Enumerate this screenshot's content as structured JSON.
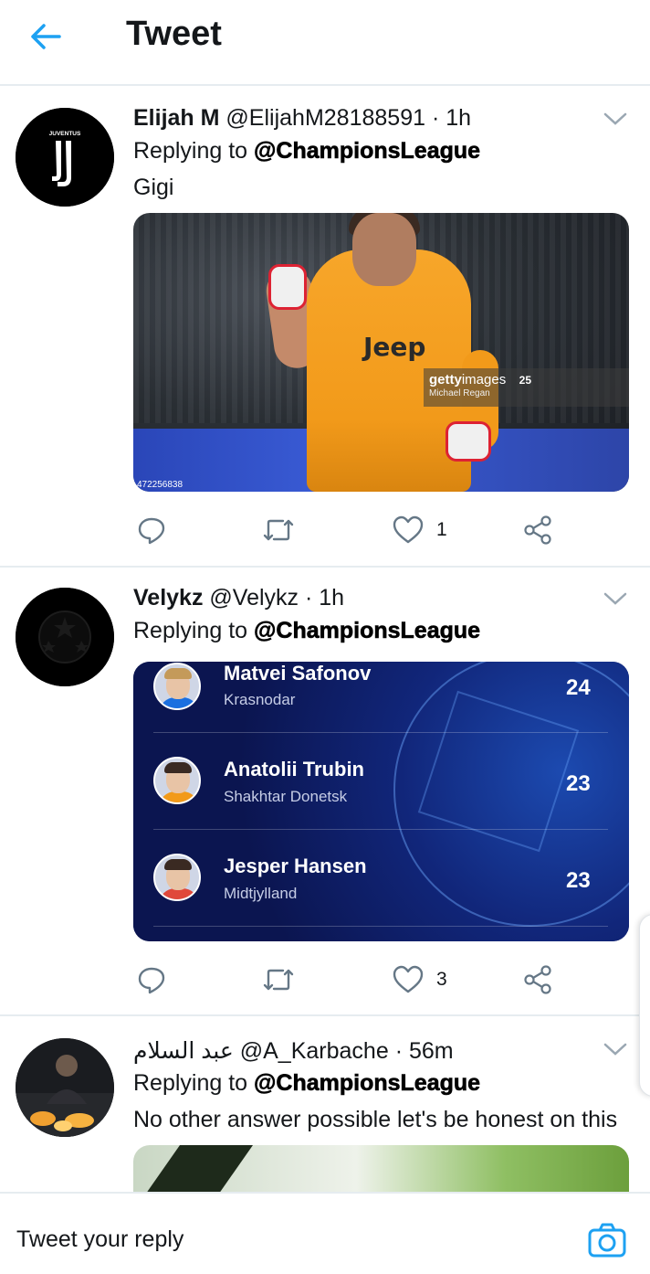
{
  "header": {
    "title": "Tweet"
  },
  "colors": {
    "accent": "#1da1f2",
    "text": "#14171a",
    "divider": "#e6ecf0",
    "card_bg": "#0e1a5a"
  },
  "tweets": [
    {
      "name": "Elijah M",
      "handle": "@ElijahM28188591",
      "separator": "·",
      "time": "1h",
      "reply_prefix": "Replying to",
      "reply_to": "@ChampionsLeague",
      "text": "Gigi",
      "avatar_icon": "juventus-logo-icon",
      "avatar_text": "JUVENTUS",
      "media": {
        "type": "photo",
        "sponsor": "Jeep",
        "watermark_brand_bold": "getty",
        "watermark_brand_light": "images",
        "watermark_years": "25",
        "watermark_credit": "Michael Regan",
        "image_id": "472256838"
      },
      "likes": "1"
    },
    {
      "name": "Velykz",
      "handle": "@Velykz",
      "separator": "·",
      "time": "1h",
      "reply_prefix": "Replying to",
      "reply_to": "@ChampionsLeague",
      "avatar_icon": "champions-league-starball-icon",
      "media": {
        "type": "stats",
        "rows": [
          {
            "name": "Matvei Safonov",
            "club": "Krasnodar",
            "value": "24",
            "shirt": "#1a6fe0"
          },
          {
            "name": "Anatolii Trubin",
            "club": "Shakhtar Donetsk",
            "value": "23",
            "shirt": "#f29a1a"
          },
          {
            "name": "Jesper Hansen",
            "club": "Midtjylland",
            "value": "23",
            "shirt": "#e0483a"
          }
        ]
      },
      "likes": "3"
    },
    {
      "name": "عبد السلام",
      "handle": "@A_Karbache",
      "separator": "·",
      "time": "56m",
      "reply_prefix": "Replying to",
      "reply_to": "@ChampionsLeague",
      "text": "No other answer possible let's be honest on this",
      "avatar_icon": "user-photo-avatar"
    }
  ],
  "reply_bar": {
    "placeholder": "Tweet your reply"
  }
}
